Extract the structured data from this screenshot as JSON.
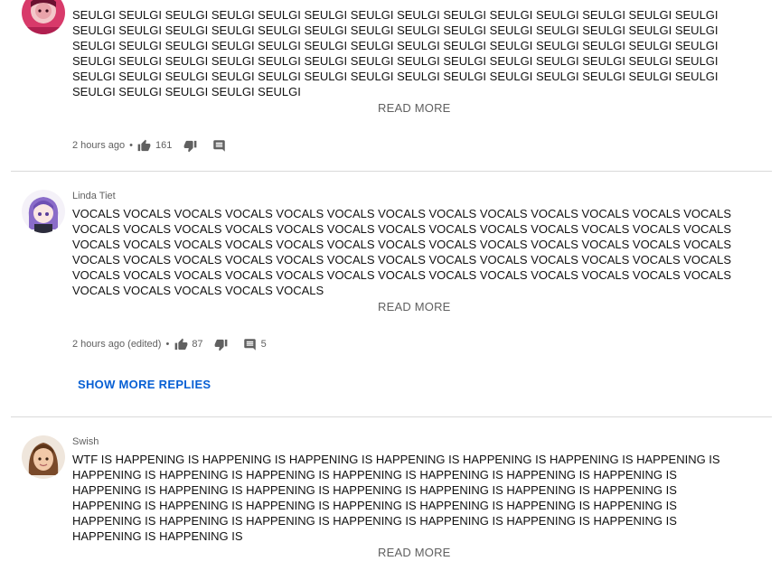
{
  "comments": [
    {
      "author": "",
      "text": "SEULGI SEULGI SEULGI SEULGI SEULGI SEULGI SEULGI SEULGI SEULGI SEULGI SEULGI SEULGI SEULGI SEULGI SEULGI SEULGI SEULGI SEULGI SEULGI SEULGI SEULGI SEULGI SEULGI SEULGI SEULGI SEULGI SEULGI SEULGI SEULGI SEULGI SEULGI SEULGI SEULGI SEULGI SEULGI SEULGI SEULGI SEULGI SEULGI SEULGI SEULGI SEULGI SEULGI SEULGI SEULGI SEULGI SEULGI SEULGI SEULGI SEULGI SEULGI SEULGI SEULGI SEULGI SEULGI SEULGI SEULGI SEULGI SEULGI SEULGI SEULGI SEULGI SEULGI SEULGI SEULGI SEULGI SEULGI SEULGI SEULGI SEULGI SEULGI SEULGI SEULGI SEULGI SEULGI",
      "read_more": "READ MORE",
      "time": "2 hours ago",
      "likes": "161",
      "replies": ""
    },
    {
      "author": "Linda Tiet",
      "text": "VOCALS VOCALS VOCALS VOCALS VOCALS VOCALS VOCALS VOCALS VOCALS VOCALS VOCALS VOCALS VOCALS VOCALS VOCALS VOCALS VOCALS VOCALS VOCALS VOCALS VOCALS VOCALS VOCALS VOCALS VOCALS VOCALS VOCALS VOCALS VOCALS VOCALS VOCALS VOCALS VOCALS VOCALS VOCALS VOCALS VOCALS VOCALS VOCALS VOCALS VOCALS VOCALS VOCALS VOCALS VOCALS VOCALS VOCALS VOCALS VOCALS VOCALS VOCALS VOCALS VOCALS VOCALS VOCALS VOCALS VOCALS VOCALS VOCALS VOCALS VOCALS VOCALS VOCALS VOCALS VOCALS VOCALS VOCALS VOCALS VOCALS VOCALS",
      "read_more": "READ MORE",
      "time": "2 hours ago (edited)",
      "likes": "87",
      "replies": "5"
    },
    {
      "author": "Swish",
      "text": "WTF IS HAPPENING IS HAPPENING IS HAPPENING IS HAPPENING IS HAPPENING IS HAPPENING IS HAPPENING IS HAPPENING IS HAPPENING IS HAPPENING IS HAPPENING IS HAPPENING IS HAPPENING IS HAPPENING IS HAPPENING IS HAPPENING IS HAPPENING IS HAPPENING IS HAPPENING IS HAPPENING IS HAPPENING IS HAPPENING IS HAPPENING IS HAPPENING IS HAPPENING IS HAPPENING IS HAPPENING IS HAPPENING IS HAPPENING IS HAPPENING IS HAPPENING IS HAPPENING IS HAPPENING IS HAPPENING IS HAPPENING IS HAPPENING IS HAPPENING IS",
      "read_more": "READ MORE"
    }
  ],
  "show_more_replies": "SHOW MORE REPLIES",
  "icons": {
    "like": "thumb-up-icon",
    "dislike": "thumb-down-icon",
    "reply": "comment-icon"
  },
  "colors": {
    "link_blue": "#065fd4",
    "meta_gray": "#606060"
  }
}
